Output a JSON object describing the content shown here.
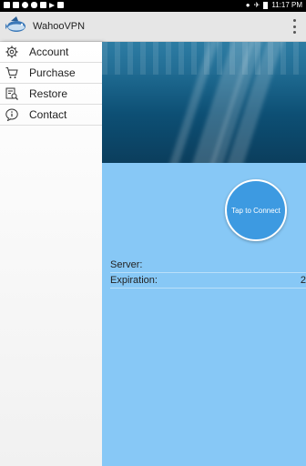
{
  "status_bar": {
    "left_icons": [
      "facebook-icon",
      "facebook-icon",
      "do-not-disturb-icon",
      "cloud-icon",
      "gmail-icon",
      "play-icon",
      "image-icon"
    ],
    "time": "11:17 PM"
  },
  "app_bar": {
    "title": "WahooVPN"
  },
  "drawer": {
    "items": [
      {
        "label": "Account",
        "icon": "gear-icon"
      },
      {
        "label": "Purchase",
        "icon": "cart-icon"
      },
      {
        "label": "Restore",
        "icon": "restore-icon"
      },
      {
        "label": "Contact",
        "icon": "info-icon"
      }
    ]
  },
  "main": {
    "connect_label": "Tap to Connect",
    "server_label": "Server:",
    "server_value": "",
    "expiration_label": "Expiration:",
    "expiration_value": "2"
  }
}
